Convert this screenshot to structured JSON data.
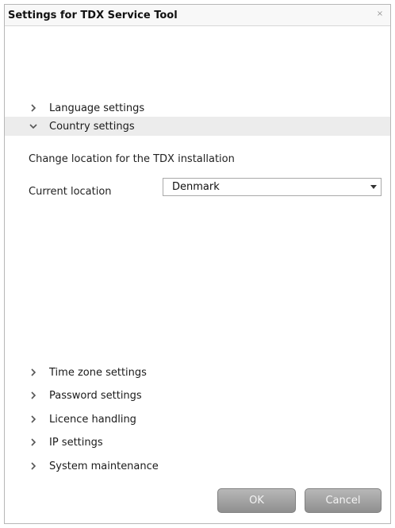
{
  "window": {
    "title": "Settings for TDX Service Tool",
    "close_glyph": "×"
  },
  "sections": [
    {
      "label": "Language settings",
      "expanded": false,
      "icon": "chevron-right-icon"
    },
    {
      "label": "Country settings",
      "expanded": true,
      "icon": "chevron-down-icon"
    },
    {
      "label": "Time zone settings",
      "expanded": false,
      "icon": "chevron-right-icon"
    },
    {
      "label": "Password settings",
      "expanded": false,
      "icon": "chevron-right-icon"
    },
    {
      "label": "Licence handling",
      "expanded": false,
      "icon": "chevron-right-icon"
    },
    {
      "label": "IP settings",
      "expanded": false,
      "icon": "chevron-right-icon"
    },
    {
      "label": "System maintenance",
      "expanded": false,
      "icon": "chevron-right-icon"
    }
  ],
  "country_settings": {
    "description": "Change location for the TDX installation",
    "location_label": "Current location",
    "location_value": "Denmark"
  },
  "buttons": {
    "ok": "OK",
    "cancel": "Cancel"
  },
  "colors": {
    "expanded_section_bg": "#ececec",
    "button_gradient_top": "#b8b8b8",
    "button_gradient_bottom": "#8f8f8f"
  }
}
